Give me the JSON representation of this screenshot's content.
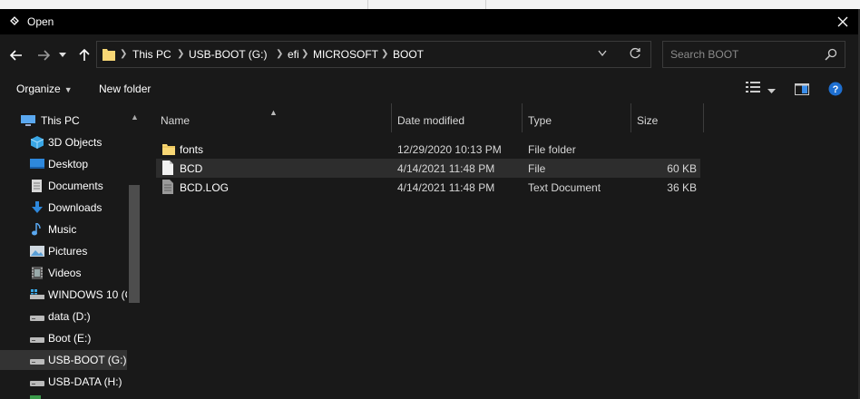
{
  "window": {
    "title": "Open"
  },
  "address": {
    "crumbs": [
      "This PC",
      "USB-BOOT (G:)",
      "efi",
      "MICROSOFT",
      "BOOT"
    ]
  },
  "search": {
    "placeholder": "Search BOOT"
  },
  "toolbar": {
    "organize": "Organize",
    "new_folder": "New folder"
  },
  "nav_pane": {
    "items": [
      {
        "label": "This PC",
        "icon": "pc-icon"
      },
      {
        "label": "3D Objects",
        "icon": "cube-icon"
      },
      {
        "label": "Desktop",
        "icon": "desktop-icon"
      },
      {
        "label": "Documents",
        "icon": "document-icon"
      },
      {
        "label": "Downloads",
        "icon": "download-icon"
      },
      {
        "label": "Music",
        "icon": "music-icon"
      },
      {
        "label": "Pictures",
        "icon": "picture-icon"
      },
      {
        "label": "Videos",
        "icon": "video-icon"
      },
      {
        "label": "WINDOWS 10 (C",
        "icon": "windows-drive-icon"
      },
      {
        "label": "data (D:)",
        "icon": "drive-icon"
      },
      {
        "label": "Boot (E:)",
        "icon": "drive-icon"
      },
      {
        "label": "USB-BOOT (G:)",
        "icon": "drive-icon"
      },
      {
        "label": "USB-DATA (H:)",
        "icon": "drive-icon"
      }
    ],
    "selected_index": 11
  },
  "columns": {
    "name": "Name",
    "date": "Date modified",
    "type": "Type",
    "size": "Size"
  },
  "files": [
    {
      "name": "fonts",
      "date": "12/29/2020 10:13 PM",
      "type": "File folder",
      "size": "",
      "icon": "folder-icon"
    },
    {
      "name": "BCD",
      "date": "4/14/2021 11:48 PM",
      "type": "File",
      "size": "60 KB",
      "icon": "file-icon"
    },
    {
      "name": "BCD.LOG",
      "date": "4/14/2021 11:48 PM",
      "type": "Text Document",
      "size": "36 KB",
      "icon": "text-file-icon"
    }
  ],
  "colors": {
    "window_bg": "#191919",
    "titlebar_bg": "#000000",
    "selected_bg": "#333333",
    "folder": "#f8d775",
    "accent_blue": "#3b8eea"
  }
}
